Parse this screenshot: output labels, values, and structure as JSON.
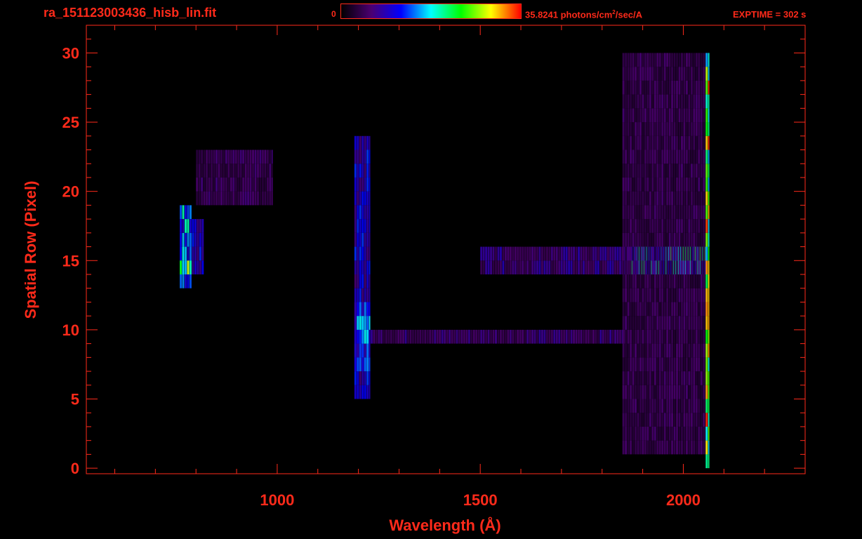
{
  "header": {
    "file_title": "ra_151123003436_hisb_lin.fit",
    "colorbar_min": "0",
    "colorbar_max_prefix": "35.8241 photons/cm",
    "colorbar_max_sup": "2",
    "colorbar_max_suffix": "/sec/A",
    "exptime": "EXPTIME = 302 s"
  },
  "colors": {
    "axis": "#ff2a1a",
    "background": "#000000",
    "colormap": [
      "#000000",
      "#4b0070",
      "#0000ff",
      "#00ffff",
      "#00ff00",
      "#ffff00",
      "#ff0000"
    ]
  },
  "chart_data": {
    "type": "heatmap",
    "xlabel": "Wavelength (Å)",
    "ylabel": "Spatial Row (Pixel)",
    "xlim": [
      530,
      2300
    ],
    "ylim": [
      -0.4,
      32
    ],
    "xticks": [
      1000,
      1500,
      2000
    ],
    "yticks": [
      0,
      5,
      10,
      15,
      20,
      25,
      30
    ],
    "value_range": [
      0,
      35.8241
    ],
    "units": "photons/cm²/sec/A",
    "spectral_cutoff_wavelength": 2060,
    "features": [
      {
        "x_range": [
          760,
          790
        ],
        "rows": [
          13,
          19
        ],
        "intensity": 0.45
      },
      {
        "x_range": [
          760,
          790
        ],
        "rows": [
          14,
          15
        ],
        "intensity": 0.65
      },
      {
        "x_range": [
          790,
          820
        ],
        "rows": [
          14,
          18
        ],
        "intensity": 0.3
      },
      {
        "x_range": [
          800,
          990
        ],
        "rows": [
          19,
          23
        ],
        "intensity": 0.15
      },
      {
        "x_range": [
          1190,
          1230
        ],
        "rows": [
          5,
          24
        ],
        "intensity": 0.3
      },
      {
        "x_range": [
          1190,
          1230
        ],
        "rows": [
          7,
          12
        ],
        "intensity": 0.42
      },
      {
        "x_range": [
          1230,
          1860
        ],
        "rows": [
          9,
          10
        ],
        "intensity": 0.18
      },
      {
        "x_range": [
          1500,
          1870
        ],
        "rows": [
          14,
          16
        ],
        "intensity": 0.2
      },
      {
        "x_range": [
          1870,
          2060
        ],
        "rows": [
          14,
          16
        ],
        "intensity": 0.48
      },
      {
        "x_range": [
          1960,
          2055
        ],
        "rows": [
          15,
          16
        ],
        "intensity": 0.58
      },
      {
        "x_range": [
          1850,
          2060
        ],
        "rows": [
          1,
          30
        ],
        "intensity": 0.14
      },
      {
        "x_range": [
          2055,
          2065
        ],
        "rows": [
          0,
          30
        ],
        "intensity": 0.8
      }
    ]
  }
}
